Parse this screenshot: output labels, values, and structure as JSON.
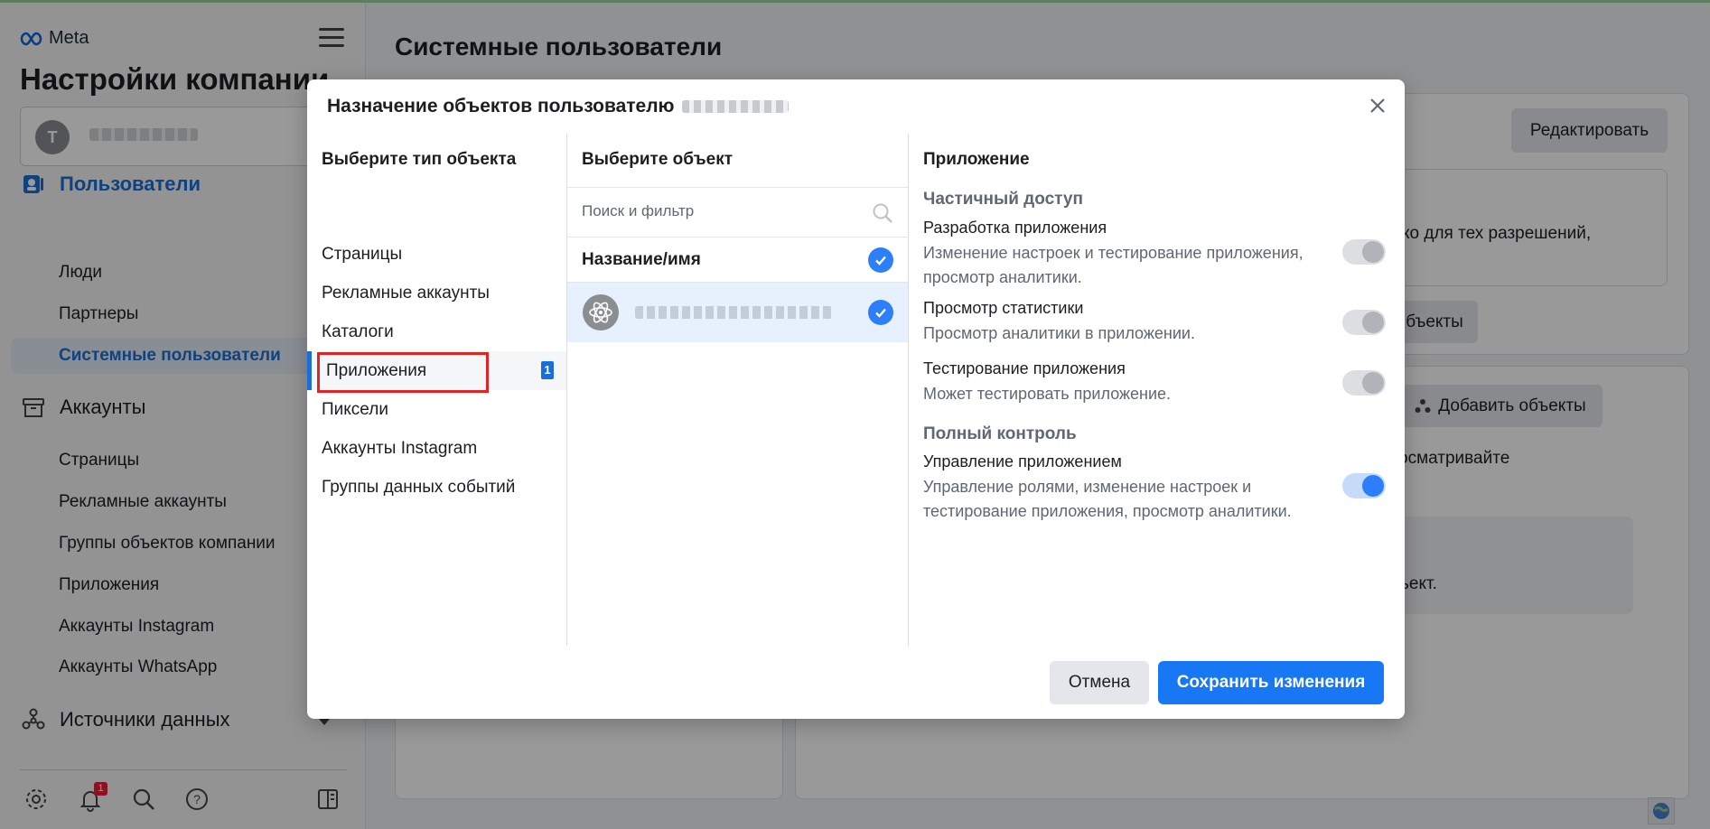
{
  "sidebar": {
    "brand": "Meta",
    "title": "Настройки компании",
    "account_initial": "T",
    "sections": {
      "users": "Пользователи",
      "accounts": "Аккаунты",
      "data_sources": "Источники данных"
    },
    "users_items": [
      "Люди",
      "Партнеры",
      "Системные пользователи"
    ],
    "accounts_items": [
      "Страницы",
      "Рекламные аккаунты",
      "Группы объектов компании",
      "Приложения",
      "Аккаунты Instagram",
      "Аккаунты WhatsApp"
    ],
    "notifications_count": "1"
  },
  "main": {
    "title": "Системные пользователи",
    "edit_button": "Редактировать",
    "assign_button_partial": "бъекты",
    "add_objects_button": "Добавить объекты",
    "text_fragment_1": "ко для тех разрешений,",
    "text_fragment_2": "осматривайте",
    "text_fragment_3": "ъект."
  },
  "modal": {
    "title": "Назначение объектов пользователю",
    "col1_header": "Выберите тип объекта",
    "object_types": [
      "Страницы",
      "Рекламные аккаунты",
      "Каталоги",
      "Приложения",
      "Пиксели",
      "Аккаунты Instagram",
      "Группы данных событий"
    ],
    "selected_type_count": "1",
    "col2_header": "Выберите объект",
    "search_placeholder": "Поиск и фильтр",
    "list_header": "Название/имя",
    "col3_header": "Приложение",
    "partial_access_label": "Частичный доступ",
    "full_control_label": "Полный контроль",
    "permissions": [
      {
        "name": "Разработка приложения",
        "description": "Изменение настроек и тестирование приложения, просмотр аналитики.",
        "enabled": false
      },
      {
        "name": "Просмотр статистики",
        "description": "Просмотр аналитики в приложении.",
        "enabled": false
      },
      {
        "name": "Тестирование приложения",
        "description": "Может тестировать приложение.",
        "enabled": false
      },
      {
        "name": "Управление приложением",
        "description": "Управление ролями, изменение настроек и тестирование приложения, просмотр аналитики.",
        "enabled": true
      }
    ],
    "cancel_button": "Отмена",
    "save_button": "Сохранить изменения"
  },
  "colors": {
    "accent": "#1877f2",
    "selection_blue": "#1a6ed8",
    "highlight_red": "#e02424"
  }
}
